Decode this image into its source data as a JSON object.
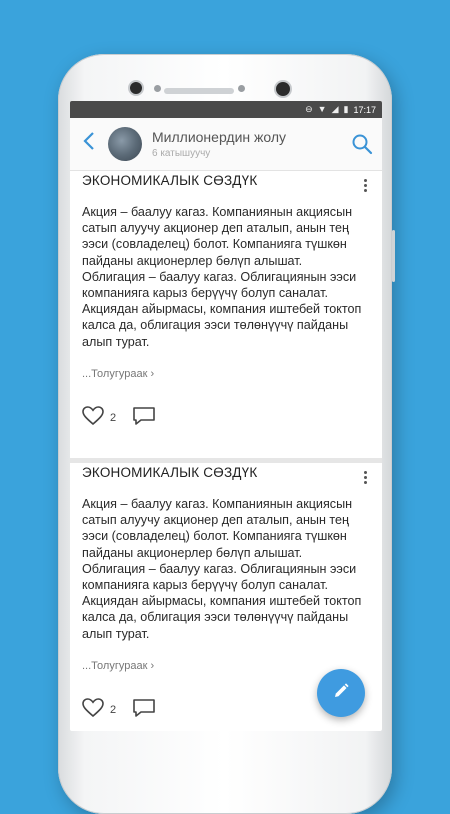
{
  "status_bar": {
    "time": "17:17"
  },
  "header": {
    "title": "Миллионердин жолу",
    "subtitle": "6 катышуучу"
  },
  "posts": [
    {
      "title": "ЭКОНОМИКАЛЫК СӨЗДҮК",
      "body": "Акция – баалуу кагаз. Компаниянын акциясын сатып алуучу акционер деп аталып, анын тең ээси (совладелец) болот. Компанияга түшкөн пайданы акционерлер бөлүп алышат.\nОблигация – баалуу кагаз. Облигациянын ээси компанияга карыз берүүчү болуп саналат. Акциядан айырмасы, компания иштебей токтоп калса да, облигация ээси төлөнүүчү пайданы алып турат.",
      "more_label": "...Толугураак",
      "likes": "2"
    },
    {
      "title": "ЭКОНОМИКАЛЫК СӨЗДҮК",
      "body": "Акция – баалуу кагаз. Компаниянын акциясын сатып алуучу акционер деп аталып, анын тең ээси (совладелец) болот. Компанияга түшкөн пайданы акционерлер бөлүп алышат.\nОблигация – баалуу кагаз. Облигациянын ээси компанияга карыз берүүчү болуп саналат. Акциядан айырмасы, компания иштебей токтоп калса да, облигация ээси төлөнүүчү пайданы алып турат.",
      "more_label": "...Толугураак",
      "likes": "2"
    }
  ],
  "icons": {
    "back": "back-arrow-icon",
    "search": "search-icon",
    "kebab": "kebab-menu-icon",
    "like": "heart-icon",
    "comment": "comment-icon",
    "fab": "pencil-icon"
  },
  "colors": {
    "background": "#3aa3dc",
    "accent": "#3a93d6",
    "fab": "#3f9be0",
    "status_bar": "#4a4a4a"
  }
}
